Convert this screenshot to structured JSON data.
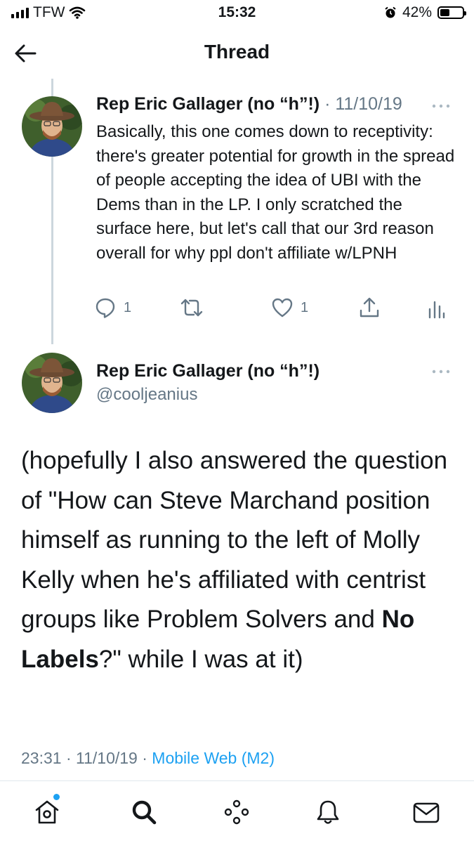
{
  "status_bar": {
    "carrier": "TFW",
    "time": "15:32",
    "battery_percent": "42%",
    "battery_level": 0.42
  },
  "header": {
    "title": "Thread"
  },
  "parent_tweet": {
    "author_name": "Rep Eric Gallager (no “h”!)",
    "separator": "·",
    "date": "11/10/19",
    "text": "Basically, this one comes down to receptivity: there's greater potential for growth in the spread of people accepting the idea of UBI with the Dems than in the LP. I only scratched the surface here, but let's call that our 3rd reason overall for why ppl don't affiliate w/LPNH",
    "reply_count": "1",
    "like_count": "1"
  },
  "main_tweet": {
    "author_name": "Rep Eric Gallager (no “h”!)",
    "handle": "@cooljeanius",
    "text_part1": "(hopefully I also answered the question of \"How can Steve Marchand position himself as running to the left of Molly Kelly when he's affiliated with centrist groups like Problem Solvers and ",
    "text_bold": "No Labels",
    "text_part2": "?\" while I was at it)",
    "time": "23:31",
    "separator": "·",
    "date": "11/10/19",
    "separator2": "·",
    "source": "Mobile Web (M2)"
  },
  "tab_bar": {
    "items": [
      {
        "icon": "home-icon",
        "notification_dot": true
      },
      {
        "icon": "search-icon"
      },
      {
        "icon": "spaces-icon"
      },
      {
        "icon": "bell-icon"
      },
      {
        "icon": "mail-icon"
      }
    ]
  },
  "colors": {
    "accent": "#1da1f2",
    "muted": "#657786",
    "thread_line": "#ccd6dd"
  }
}
